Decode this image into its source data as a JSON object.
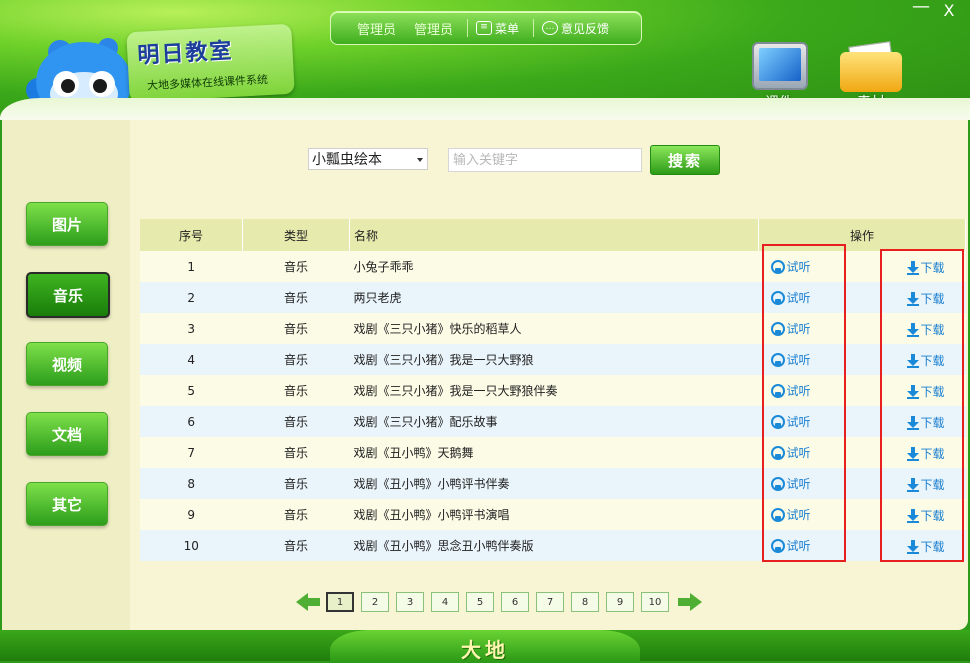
{
  "brand": {
    "title": "明日教室",
    "subtitle": "大地多媒体在线课件系统"
  },
  "topbar": {
    "user1": "管理员",
    "user2": "管理员",
    "menu_label": "菜单",
    "feedback_label": "意见反馈"
  },
  "window": {
    "minimize": "—",
    "close": "X"
  },
  "modules": {
    "courseware": "课件",
    "material": "素材"
  },
  "sidebar": {
    "items": [
      "图片",
      "音乐",
      "视频",
      "文档",
      "其它"
    ],
    "active": "音乐"
  },
  "search": {
    "selected_category": "小瓢虫绘本",
    "placeholder": "输入关键字",
    "button": "搜索"
  },
  "table": {
    "headers": {
      "index": "序号",
      "type": "类型",
      "name": "名称",
      "actions": "操作"
    },
    "listen_label": "试听",
    "download_label": "下载",
    "rows": [
      {
        "index": "1",
        "type": "音乐",
        "name": "小兔子乖乖"
      },
      {
        "index": "2",
        "type": "音乐",
        "name": "两只老虎"
      },
      {
        "index": "3",
        "type": "音乐",
        "name": "戏剧《三只小猪》快乐的稻草人"
      },
      {
        "index": "4",
        "type": "音乐",
        "name": "戏剧《三只小猪》我是一只大野狼"
      },
      {
        "index": "5",
        "type": "音乐",
        "name": "戏剧《三只小猪》我是一只大野狼伴奏"
      },
      {
        "index": "6",
        "type": "音乐",
        "name": "戏剧《三只小猪》配乐故事"
      },
      {
        "index": "7",
        "type": "音乐",
        "name": "戏剧《丑小鸭》天鹅舞"
      },
      {
        "index": "8",
        "type": "音乐",
        "name": "戏剧《丑小鸭》小鸭评书伴奏"
      },
      {
        "index": "9",
        "type": "音乐",
        "name": "戏剧《丑小鸭》小鸭评书演唱"
      },
      {
        "index": "10",
        "type": "音乐",
        "name": "戏剧《丑小鸭》思念丑小鸭伴奏版"
      }
    ]
  },
  "pagination": {
    "pages": [
      "1",
      "2",
      "3",
      "4",
      "5",
      "6",
      "7",
      "8",
      "9",
      "10"
    ],
    "current": "1"
  },
  "footer": {
    "logo": "大地"
  },
  "colors": {
    "brand_green": "#2e9a1a",
    "highlight_red": "#e81f1f",
    "link_blue": "#1a7fd0"
  }
}
